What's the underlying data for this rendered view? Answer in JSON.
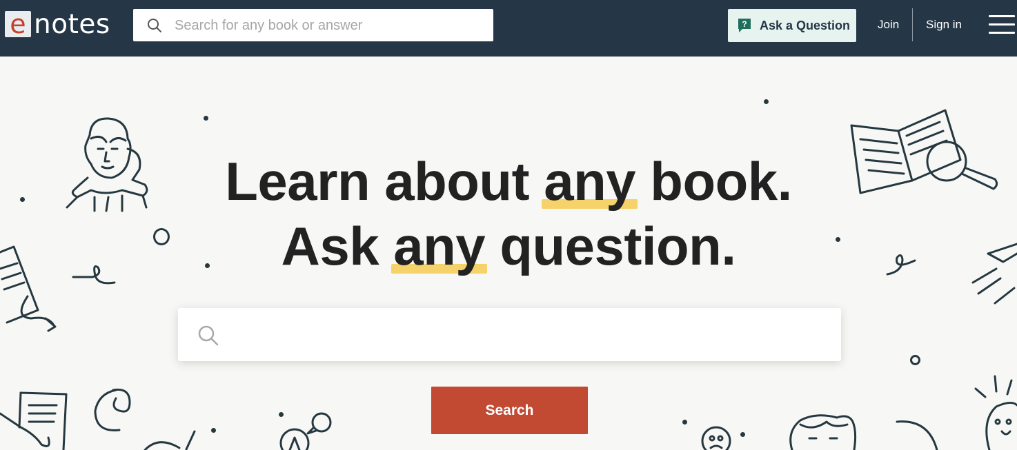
{
  "nav": {
    "logo_letter": "e",
    "logo_text": "notes",
    "search_placeholder": "Search for any book or answer",
    "ask_label": "Ask a Question",
    "join_label": "Join",
    "signin_label": "Sign in"
  },
  "hero": {
    "line1_a": "Learn about ",
    "line1_hl": "any",
    "line1_b": " book.",
    "line2_a": "Ask ",
    "line2_hl": "any",
    "line2_b": " question.",
    "search_placeholder": "",
    "search_button": "Search"
  },
  "colors": {
    "nav_bg": "#253746",
    "accent_red": "#c24a33",
    "highlight_yellow": "#f5d26a",
    "ask_button_bg": "#e6f3ef"
  },
  "icons": [
    "search-icon",
    "question-bubble-icon",
    "menu-icon"
  ]
}
